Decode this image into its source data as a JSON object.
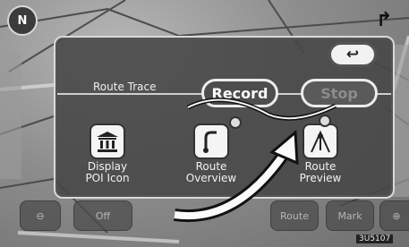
{
  "map": {
    "turn_arrow": "↱",
    "compass_glyph": "N"
  },
  "panel": {
    "back_icon": "↩",
    "route_trace_label": "Route Trace",
    "record_label": "Record",
    "stop_label": "Stop"
  },
  "options": [
    {
      "label_line1": "Display",
      "label_line2": "POI Icon",
      "icon": "museum-icon"
    },
    {
      "label_line1": "Route",
      "label_line2": "Overview",
      "icon": "route-overview-icon"
    },
    {
      "label_line1": "Route",
      "label_line2": "Preview",
      "icon": "route-preview-icon"
    }
  ],
  "bottom_bar": {
    "zoom_out": "⊖",
    "off_label": "Off",
    "route_label": "Route",
    "mark_label": "Mark",
    "zoom_in": "⊕"
  },
  "colors": {
    "panel": "#464646",
    "button_border": "#ececec",
    "text": "#f2f2f2"
  },
  "figure_code": "3U5107"
}
